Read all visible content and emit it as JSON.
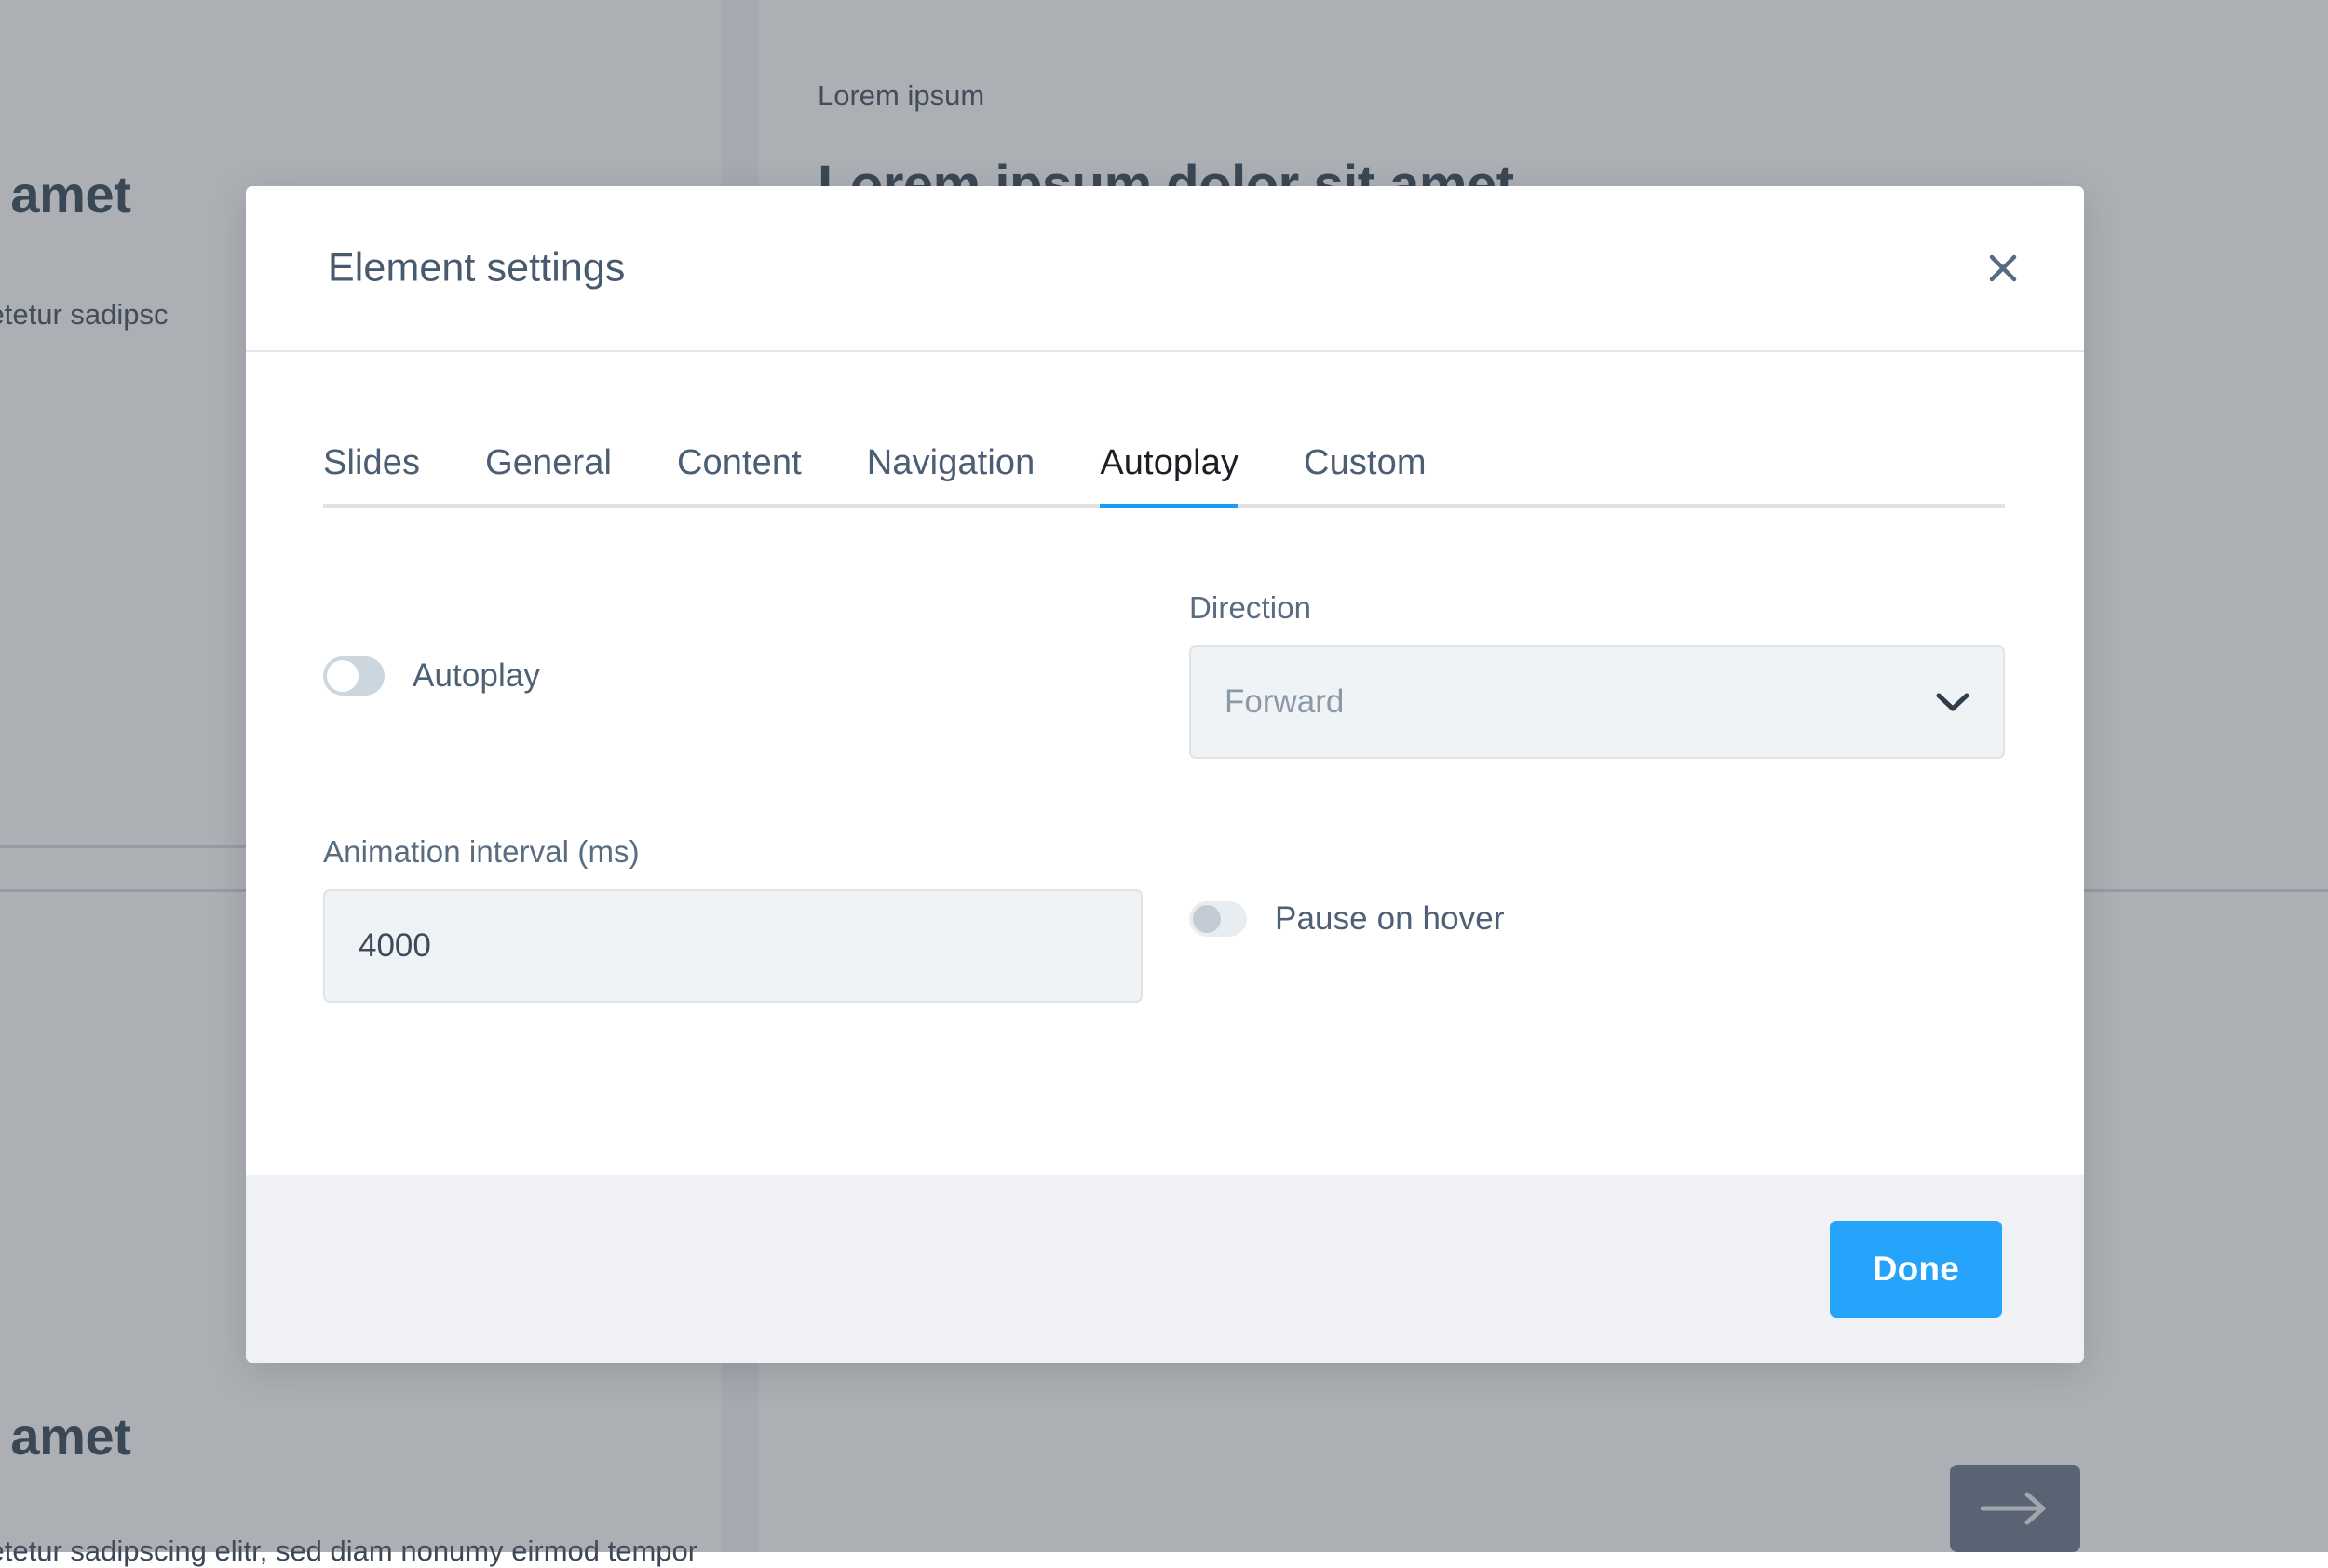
{
  "background": {
    "slides": [
      {
        "heading": "t amet",
        "body": "setetur sadipsc"
      },
      {
        "eyebrow": "Lorem ipsum",
        "title": "Lorem ipsum dolor sit amet"
      },
      {
        "heading": "t amet",
        "body": "setetur sadipscing elitr, sed diam nonumy eirmod tempor"
      }
    ],
    "next_button_icon": "arrow-right-icon"
  },
  "modal": {
    "title": "Element settings",
    "close_icon": "close-icon",
    "tabs": [
      {
        "label": "Slides",
        "active": false
      },
      {
        "label": "General",
        "active": false
      },
      {
        "label": "Content",
        "active": false
      },
      {
        "label": "Navigation",
        "active": false
      },
      {
        "label": "Autoplay",
        "active": true
      },
      {
        "label": "Custom",
        "active": false
      }
    ],
    "active_tab": "Autoplay",
    "fields": {
      "autoplay_toggle_label": "Autoplay",
      "autoplay_toggle_state": "off",
      "direction_label": "Direction",
      "direction_value": "Forward",
      "direction_chevron_icon": "chevron-down-icon",
      "interval_label": "Animation interval (ms)",
      "interval_value": "4000",
      "interval_placeholder": "4000",
      "pause_on_hover_label": "Pause on hover",
      "pause_on_hover_state": "off"
    },
    "footer": {
      "done_label": "Done"
    }
  },
  "colors": {
    "accent_blue": "#26a4fb",
    "tab_underline": "#159cfb",
    "title_slate": "#475a6e",
    "footer_bg": "#eff1f4",
    "control_bg": "#f0f3f5",
    "overlay": "rgba(75,83,94,0.46)"
  }
}
